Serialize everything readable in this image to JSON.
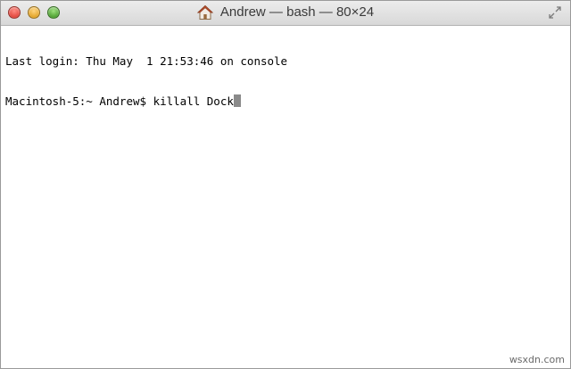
{
  "window": {
    "title": "Andrew — bash — 80×24",
    "title_icon": "home-icon",
    "fullscreen_icon": "fullscreen-arrows-icon"
  },
  "terminal": {
    "lines": [
      "Last login: Thu May  1 21:53:46 on console"
    ],
    "prompt": "Macintosh-5:~ Andrew$ ",
    "command": "killall Dock"
  },
  "watermark": "wsxdn.com",
  "colors": {
    "close": "#e2473d",
    "minimize": "#e3a528",
    "zoom": "#4fa232",
    "cursor": "#8a8a8a"
  }
}
